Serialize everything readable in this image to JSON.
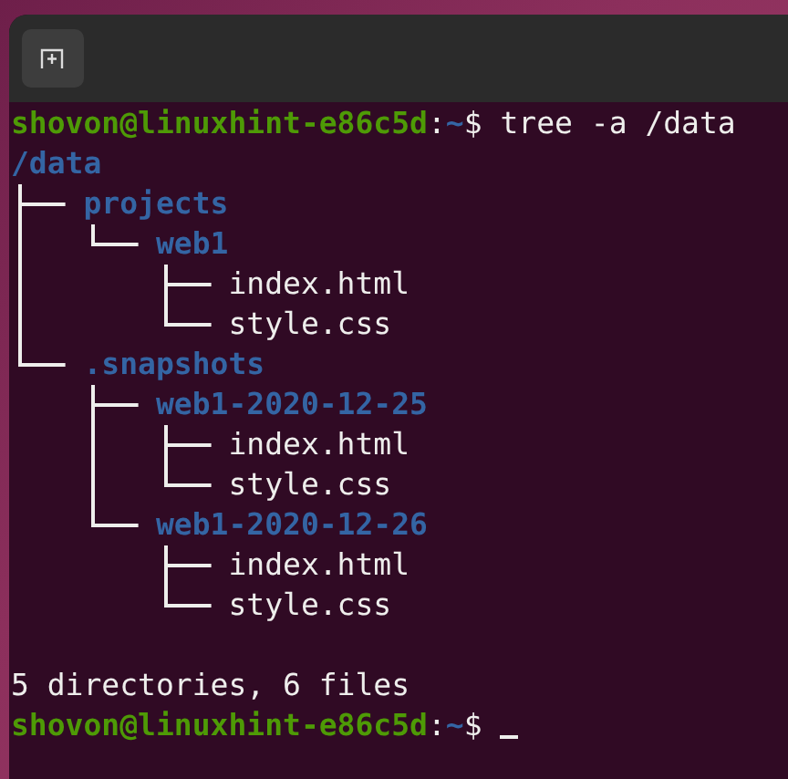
{
  "terminal": [
    {
      "kind": "prompt",
      "user_host": "shovon@linuxhint-e86c5d",
      "separator": ":",
      "path": "~",
      "symbol": "$",
      "command": "tree -a /data"
    },
    {
      "kind": "tree",
      "root": "/data",
      "children": [
        {
          "name": "projects",
          "kind": "directory",
          "children": [
            {
              "name": "web1",
              "kind": "directory",
              "children": [
                {
                  "name": "index.html",
                  "kind": "file"
                },
                {
                  "name": "style.css",
                  "kind": "file"
                }
              ]
            }
          ]
        },
        {
          "name": ".snapshots",
          "kind": "directory",
          "children": [
            {
              "name": "web1-2020-12-25",
              "kind": "directory",
              "children": [
                {
                  "name": "index.html",
                  "kind": "file"
                },
                {
                  "name": "style.css",
                  "kind": "file"
                }
              ]
            },
            {
              "name": "web1-2020-12-26",
              "kind": "directory",
              "children": [
                {
                  "name": "index.html",
                  "kind": "file"
                },
                {
                  "name": "style.css",
                  "kind": "file"
                }
              ]
            }
          ]
        }
      ]
    },
    {
      "kind": "blank"
    },
    {
      "kind": "output",
      "text": "5 directories, 6 files"
    },
    {
      "kind": "prompt",
      "user_host": "shovon@linuxhint-e86c5d",
      "separator": ":",
      "path": "~",
      "symbol": "$",
      "cursor": true
    }
  ]
}
